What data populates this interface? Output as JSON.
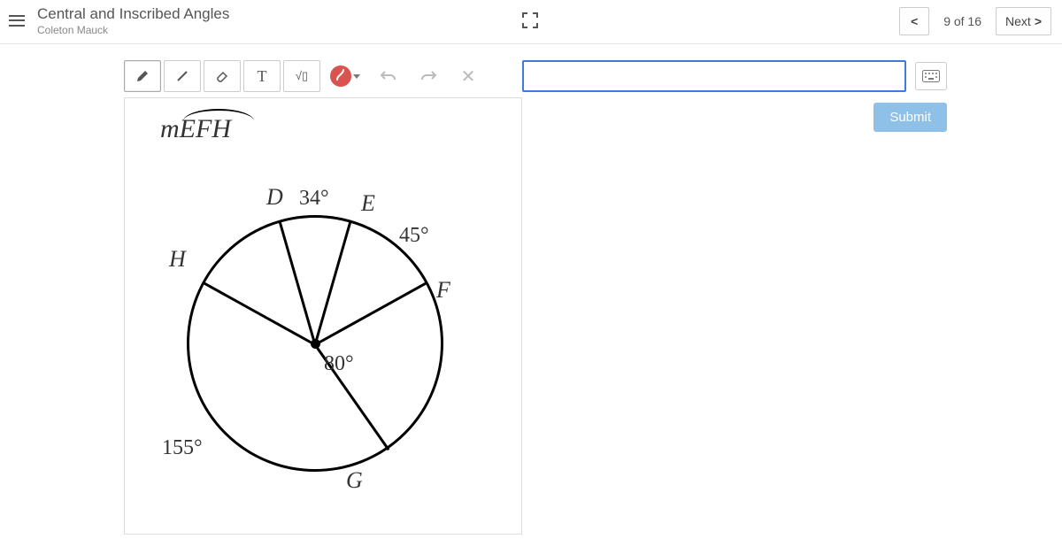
{
  "header": {
    "title": "Central and Inscribed Angles",
    "subtitle": "Coleton Mauck",
    "progress": "9 of 16",
    "next": "Next"
  },
  "question": {
    "expr_prefix": "m",
    "arc": "EFH"
  },
  "diagram": {
    "points": {
      "D": "D",
      "E": "E",
      "F": "F",
      "G": "G",
      "H": "H"
    },
    "angles": {
      "de": "34°",
      "ef": "45°",
      "fg": "80°",
      "gh": "155°"
    }
  },
  "answer": {
    "value": "",
    "submit": "Submit"
  }
}
